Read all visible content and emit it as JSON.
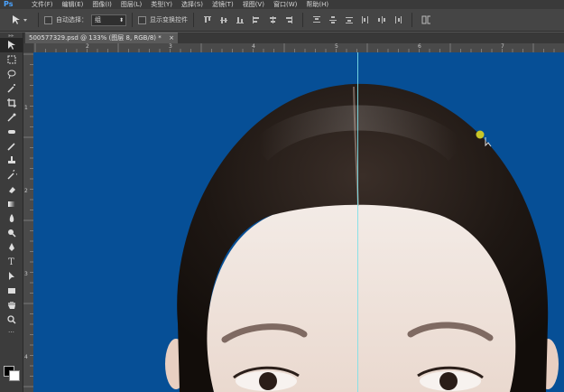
{
  "app": {
    "logo": "Ps"
  },
  "menu": [
    "文件(F)",
    "编辑(E)",
    "图像(I)",
    "图层(L)",
    "类型(Y)",
    "选择(S)",
    "滤镜(T)",
    "视图(V)",
    "窗口(W)",
    "帮助(H)"
  ],
  "options": {
    "auto_select_label": "自动选择：",
    "auto_select_value": "组",
    "show_transform_label": "显示变换控件"
  },
  "document": {
    "tab_title": "500577329.psd @ 133% (图层 8, RGB/8) *",
    "close": "×"
  },
  "rulers": {
    "horizontal": [
      "2",
      "3",
      "4",
      "5",
      "6",
      "7"
    ],
    "vertical": [
      "1",
      "2",
      "3",
      "4",
      "5"
    ]
  },
  "colors": {
    "canvas_bg": "#064f96",
    "guide": "#7ee0e8"
  },
  "icons": {
    "tools": [
      "move-icon",
      "marquee-icon",
      "lasso-icon",
      "magic-wand-icon",
      "crop-icon",
      "eyedropper-icon",
      "healing-icon",
      "brush-icon",
      "stamp-icon",
      "history-brush-icon",
      "eraser-icon",
      "gradient-icon",
      "blur-icon",
      "dodge-icon",
      "pen-icon",
      "type-icon",
      "path-select-icon",
      "shape-icon",
      "hand-icon",
      "zoom-icon"
    ]
  }
}
